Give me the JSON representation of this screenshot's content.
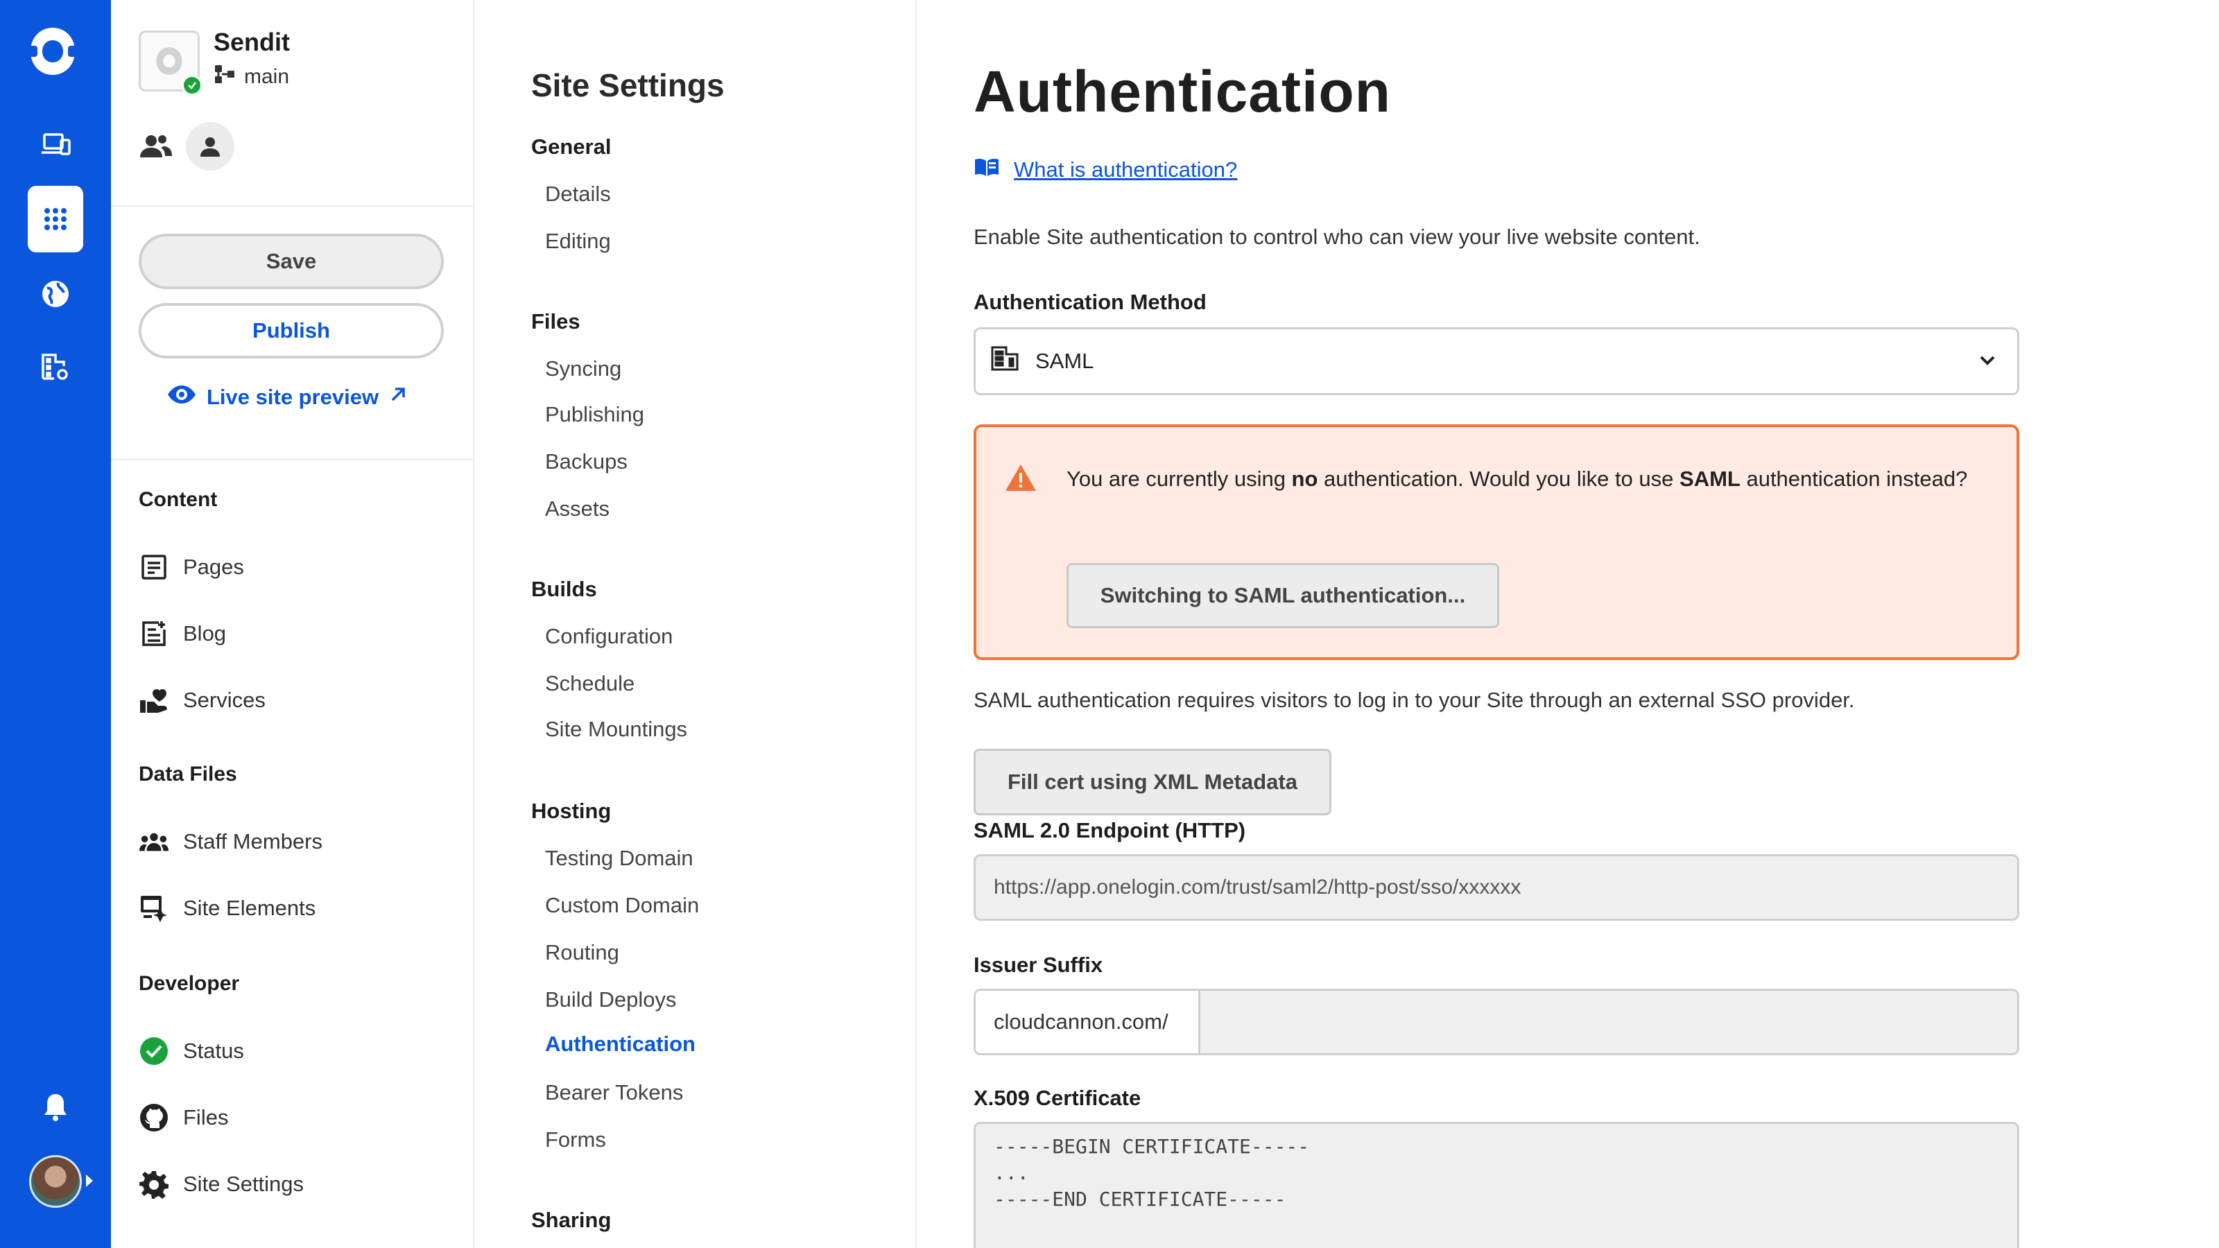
{
  "app": {
    "colors": {
      "brand": "#0a56dd",
      "warning_border": "#f0733a",
      "warning_bg": "#ffebe3",
      "success": "#1aa33a"
    }
  },
  "rail": {
    "items": [
      {
        "icon": "devices-icon"
      },
      {
        "icon": "grid-apps-icon",
        "active": true
      },
      {
        "icon": "globe-icon"
      },
      {
        "icon": "organization-settings-icon"
      }
    ],
    "bottom": [
      {
        "icon": "bell-icon"
      },
      {
        "icon": "avatar"
      }
    ]
  },
  "site": {
    "name": "Sendit",
    "branch": "main",
    "save_label": "Save",
    "publish_label": "Publish",
    "preview_label": "Live site preview",
    "sections": [
      {
        "title": "Content",
        "items": [
          {
            "label": "Pages",
            "icon": "page-icon"
          },
          {
            "label": "Blog",
            "icon": "blog-post-icon"
          },
          {
            "label": "Services",
            "icon": "services-icon"
          }
        ]
      },
      {
        "title": "Data Files",
        "items": [
          {
            "label": "Staff Members",
            "icon": "group-icon"
          },
          {
            "label": "Site Elements",
            "icon": "site-elements-icon"
          }
        ]
      },
      {
        "title": "Developer",
        "items": [
          {
            "label": "Status",
            "icon": "status-check-icon"
          },
          {
            "label": "Files",
            "icon": "github-icon"
          },
          {
            "label": "Site Settings",
            "icon": "gear-icon"
          }
        ]
      }
    ]
  },
  "settings": {
    "title": "Site Settings",
    "groups": [
      {
        "title": "General",
        "items": [
          "Details",
          "Editing"
        ]
      },
      {
        "title": "Files",
        "items": [
          "Syncing",
          "Publishing",
          "Backups",
          "Assets"
        ]
      },
      {
        "title": "Builds",
        "items": [
          "Configuration",
          "Schedule",
          "Site Mountings"
        ]
      },
      {
        "title": "Hosting",
        "items": [
          "Testing Domain",
          "Custom Domain",
          "Routing",
          "Build Deploys",
          "Authentication",
          "Bearer Tokens",
          "Forms"
        ]
      },
      {
        "title": "Sharing",
        "items": []
      }
    ],
    "active_item": "Authentication"
  },
  "main": {
    "title": "Authentication",
    "help_link": "What is authentication?",
    "intro": "Enable Site authentication to control who can view your live website content.",
    "method_label": "Authentication Method",
    "method_value": "SAML",
    "warning": {
      "part1": "You are currently using ",
      "bold1": "no",
      "part2": " authentication. Would you like to use ",
      "bold2": "SAML",
      "part3": " authentication instead?",
      "button": "Switching to SAML authentication..."
    },
    "saml_desc": "SAML authentication requires visitors to log in to your Site through an external SSO provider.",
    "fill_button": "Fill cert using XML Metadata",
    "endpoint_label": "SAML 2.0 Endpoint (HTTP)",
    "endpoint_placeholder": "https://app.onelogin.com/trust/saml2/http-post/sso/xxxxxx",
    "issuer_label": "Issuer Suffix",
    "issuer_prefix": "cloudcannon.com/",
    "issuer_value": "",
    "cert_label": "X.509 Certificate",
    "cert_value": "-----BEGIN CERTIFICATE-----\n...\n-----END CERTIFICATE-----"
  }
}
